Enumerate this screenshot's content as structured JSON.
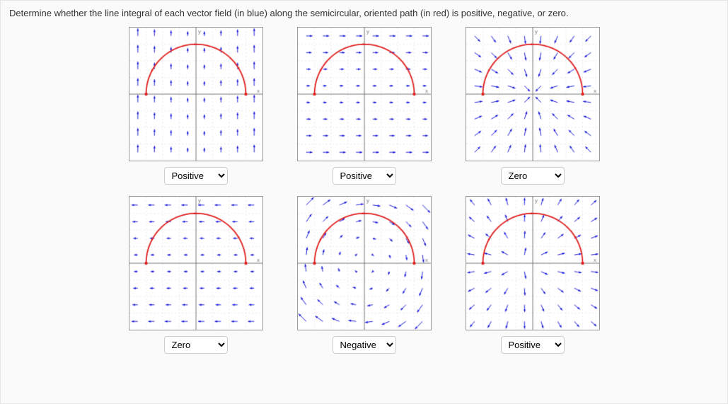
{
  "prompt": "Determine whether the line integral of each vector field (in blue) along the semicircular, oriented path (in red) is positive, negative, or zero.",
  "options": [
    "Positive",
    "Negative",
    "Zero"
  ],
  "plots": [
    {
      "id": "p1",
      "field": "up",
      "selected": "Positive"
    },
    {
      "id": "p2",
      "field": "right",
      "selected": "Positive"
    },
    {
      "id": "p3",
      "field": "radial_in",
      "selected": "Zero"
    },
    {
      "id": "p4",
      "field": "left",
      "selected": "Zero"
    },
    {
      "id": "p5",
      "field": "rot_cw",
      "selected": "Negative"
    },
    {
      "id": "p6",
      "field": "source_left",
      "selected": "Positive"
    }
  ],
  "semicircle": {
    "cx": 0,
    "cy": 0,
    "r": 0.75,
    "start_angle": 180,
    "end_angle": 0,
    "orientation": "counterclockwise"
  },
  "axes": {
    "xlim": [
      -1,
      1
    ],
    "ylim": [
      -1,
      1
    ],
    "xlabel": "x",
    "ylabel": "y"
  },
  "colors": {
    "vector": "#1919d8",
    "path": "#e02020",
    "axis": "#777",
    "grid": "#e8e8e8",
    "tick": "#777"
  }
}
